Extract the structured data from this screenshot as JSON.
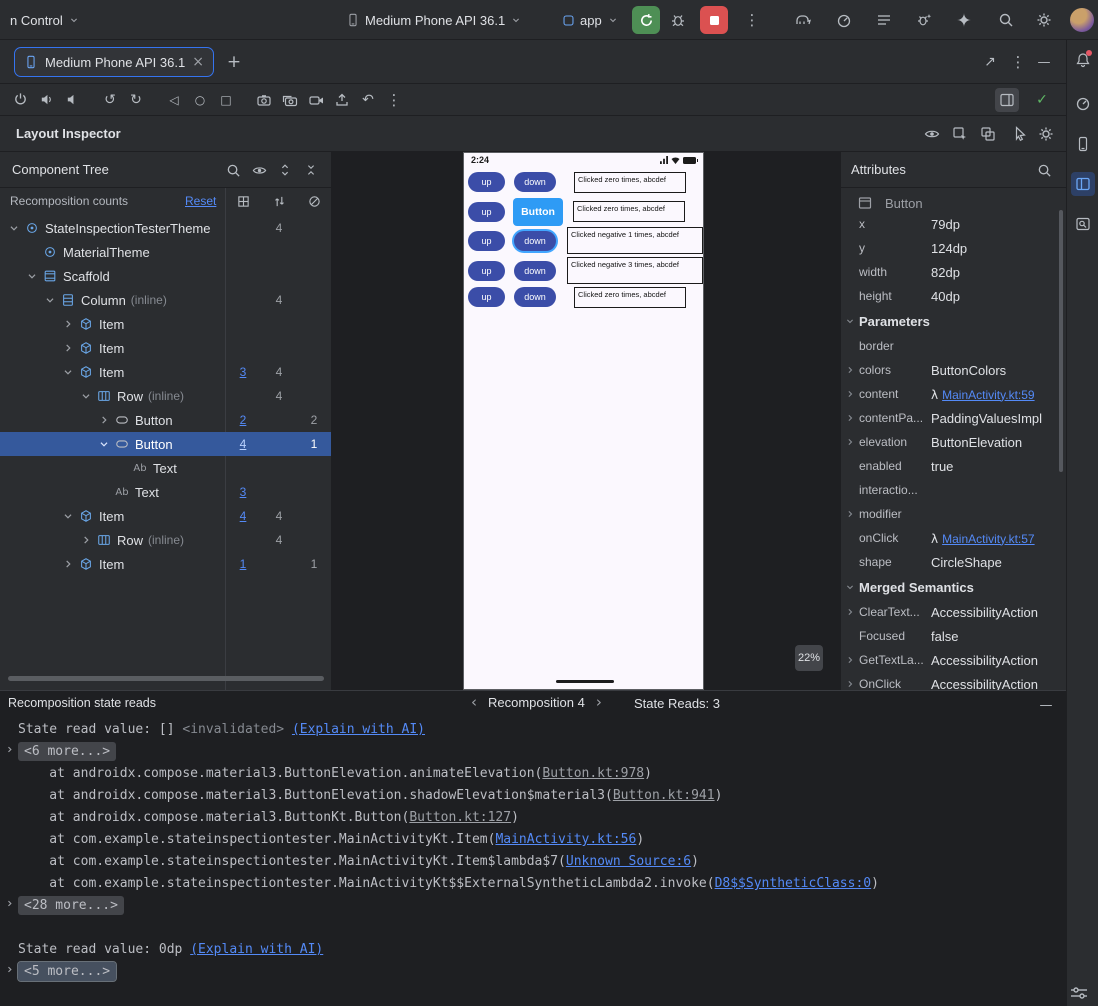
{
  "toolbar": {
    "vcs": "n Control",
    "device": "Medium Phone API 36.1",
    "run_config": "app"
  },
  "tabs": {
    "active": "Medium Phone API 36.1"
  },
  "inspector_bar": {
    "title": "Layout Inspector"
  },
  "tree": {
    "title": "Component Tree",
    "counts_label": "Recomposition counts",
    "reset": "Reset",
    "rows": [
      {
        "label": "StateInspectionTesterTheme",
        "c2": "4"
      },
      {
        "label": "MaterialTheme"
      },
      {
        "label": "Scaffold"
      },
      {
        "label": "Column",
        "suffix": "(inline)",
        "c2": "4"
      },
      {
        "label": "Item"
      },
      {
        "label": "Item"
      },
      {
        "label": "Item",
        "c1": "3",
        "c2": "4"
      },
      {
        "label": "Row",
        "suffix": "(inline)",
        "c2": "4"
      },
      {
        "label": "Button",
        "c1": "2",
        "c3": "2"
      },
      {
        "label": "Button",
        "c1": "4",
        "c3": "1"
      },
      {
        "label": "Text"
      },
      {
        "label": "Text",
        "c1": "3"
      },
      {
        "label": "Item",
        "c1": "4",
        "c2": "4"
      },
      {
        "label": "Row",
        "suffix": "(inline)",
        "c2": "4"
      },
      {
        "label": "Item",
        "c1": "1",
        "c3": "1"
      }
    ]
  },
  "attributes": {
    "title": "Attributes",
    "component": "Button",
    "props": [
      {
        "name": "x",
        "value": "79dp"
      },
      {
        "name": "y",
        "value": "124dp"
      },
      {
        "name": "width",
        "value": "82dp"
      },
      {
        "name": "height",
        "value": "40dp"
      }
    ],
    "parameters_label": "Parameters",
    "params": [
      {
        "name": "border",
        "value": ""
      },
      {
        "name": "colors",
        "value": "ButtonColors"
      },
      {
        "name": "content",
        "link": "MainActivity.kt:59"
      },
      {
        "name": "contentPa...",
        "value": "PaddingValuesImpl"
      },
      {
        "name": "elevation",
        "value": "ButtonElevation"
      },
      {
        "name": "enabled",
        "value": "true"
      },
      {
        "name": "interactio...",
        "value": ""
      },
      {
        "name": "modifier",
        "value": ""
      },
      {
        "name": "onClick",
        "link": "MainActivity.kt:57"
      },
      {
        "name": "shape",
        "value": "CircleShape"
      }
    ],
    "semantics_label": "Merged Semantics",
    "semantics": [
      {
        "name": "ClearText...",
        "value": "AccessibilityAction"
      },
      {
        "name": "Focused",
        "value": "false"
      },
      {
        "name": "GetTextLa...",
        "value": "AccessibilityAction"
      },
      {
        "name": "OnClick",
        "value": "AccessibilityAction"
      }
    ]
  },
  "device_screen": {
    "time": "2:24",
    "zoom": "22%",
    "rows": [
      {
        "b1": "up",
        "b2": "down",
        "text": "Clicked zero times, abcdef"
      },
      {
        "b1": "up",
        "b2": "Button",
        "text": "Clicked zero times, abcdef"
      },
      {
        "b1": "up",
        "b2": "down",
        "text": "Clicked negative 1 times, abcdef"
      },
      {
        "b1": "up",
        "b2": "down",
        "text": "Clicked negative 3 times, abcdef"
      },
      {
        "b1": "up",
        "b2": "down",
        "text": "Clicked zero times, abcdef"
      }
    ]
  },
  "console": {
    "title": "Recomposition state reads",
    "nav_label": "Recomposition 4",
    "state_reads": "State Reads: 3",
    "lines": [
      {
        "pre": "State read value: [] ",
        "dim": "<invalidated>",
        "link": "(Explain with AI)"
      },
      {
        "fold": "<6 more...>"
      },
      {
        "pre": "    at androidx.compose.material3.ButtonElevation.animateElevation(",
        "link": "Button.kt:978",
        "post": ")"
      },
      {
        "pre": "    at androidx.compose.material3.ButtonElevation.shadowElevation$material3(",
        "link": "Button.kt:941",
        "post": ")"
      },
      {
        "pre": "    at androidx.compose.material3.ButtonKt.Button(",
        "link": "Button.kt:127",
        "post": ")"
      },
      {
        "pre": "    at com.example.stateinspectiontester.MainActivityKt.Item(",
        "link": "MainActivity.kt:56",
        "post": ")"
      },
      {
        "pre": "    at com.example.stateinspectiontester.MainActivityKt.Item$lambda$7(",
        "link": "Unknown Source:6",
        "post": ")"
      },
      {
        "pre": "    at com.example.stateinspectiontester.MainActivityKt$$ExternalSyntheticLambda2.invoke(",
        "link": "D8$$SyntheticClass:0",
        "post": ")"
      },
      {
        "fold": "<28 more...>"
      },
      {
        "blank": true
      },
      {
        "pre": "State read value: 0dp ",
        "link": "(Explain with AI)"
      },
      {
        "fold": "<5 more...>"
      }
    ]
  },
  "icons": {
    "close": "×",
    "add": "+",
    "more": "⋮",
    "minimize": "—",
    "prev": "‹",
    "next": "›",
    "check": "✓",
    "nav_back": "◁",
    "nav_home": "○",
    "nav_recents": "□",
    "rotate_left": "↺",
    "rotate_right": "↻",
    "open_new": "↗",
    "lambda": "λ",
    "text_node": "Ab"
  }
}
